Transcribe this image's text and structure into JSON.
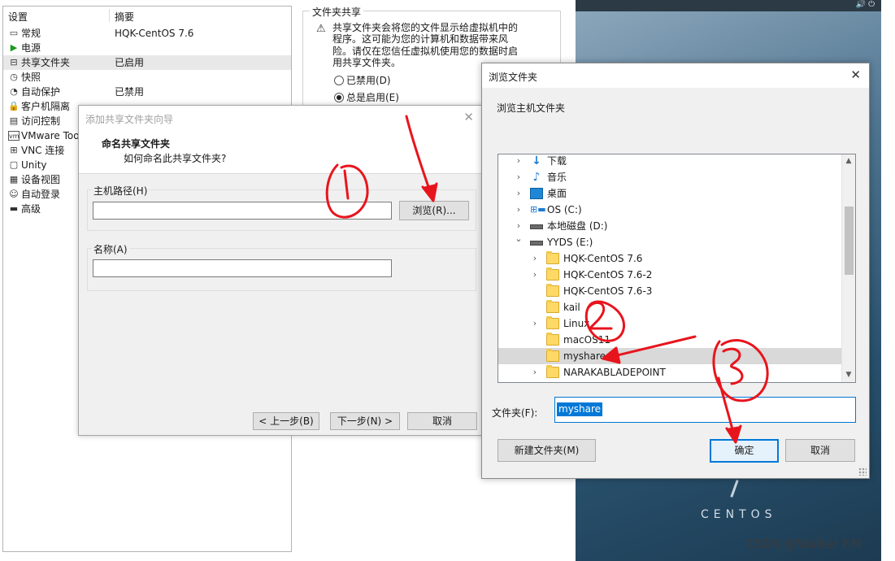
{
  "settings": {
    "header": {
      "col1": "设置",
      "col2": "摘要"
    },
    "items": [
      {
        "name": "常规",
        "value": "HQK-CentOS 7.6",
        "icon": "monitor-icon"
      },
      {
        "name": "电源",
        "value": "",
        "icon": "play-icon"
      },
      {
        "name": "共享文件夹",
        "value": "已启用",
        "icon": "shared-folder-icon"
      },
      {
        "name": "快照",
        "value": "",
        "icon": "snapshot-icon"
      },
      {
        "name": "自动保护",
        "value": "已禁用",
        "icon": "autoprotect-icon"
      },
      {
        "name": "客户机隔离",
        "value": "",
        "icon": "lock-icon"
      },
      {
        "name": "访问控制",
        "value": "",
        "icon": "access-control-icon"
      },
      {
        "name": "VMware Too",
        "value": "",
        "icon": "vmware-icon"
      },
      {
        "name": "VNC 连接",
        "value": "",
        "icon": "vnc-icon"
      },
      {
        "name": "Unity",
        "value": "",
        "icon": "unity-icon"
      },
      {
        "name": "设备视图",
        "value": "",
        "icon": "device-view-icon"
      },
      {
        "name": "自动登录",
        "value": "",
        "icon": "autologin-icon"
      },
      {
        "name": "高级",
        "value": "",
        "icon": "advanced-icon"
      }
    ]
  },
  "folder_share": {
    "title": "文件夹共享",
    "warning": "共享文件夹会将您的文件显示给虚拟机中的程序。这可能为您的计算机和数据带来风险。请仅在您信任虚拟机使用您的数据时启用共享文件夹。",
    "options": [
      "已禁用(D)",
      "总是启用(E)"
    ],
    "selected": "总是启用(E)"
  },
  "wizard": {
    "title": "添加共享文件夹向导",
    "heading": "命名共享文件夹",
    "subheading": "如何命名此共享文件夹?",
    "host_path_label": "主机路径(H)",
    "browse_button": "浏览(R)...",
    "name_label": "名称(A)",
    "back_button": "< 上一步(B)",
    "next_button": "下一步(N) >",
    "cancel_button": "取消"
  },
  "browse": {
    "title": "浏览文件夹",
    "description": "浏览主机文件夹",
    "tree": [
      {
        "label": "下载",
        "icon": "download-icon",
        "chevron": "right",
        "indent": 0
      },
      {
        "label": "音乐",
        "icon": "music-icon",
        "chevron": "right",
        "indent": 0
      },
      {
        "label": "桌面",
        "icon": "desktop-icon",
        "chevron": "right",
        "indent": 0
      },
      {
        "label": "OS (C:)",
        "icon": "os-drive-icon",
        "chevron": "right",
        "indent": 0
      },
      {
        "label": "本地磁盘 (D:)",
        "icon": "drive-icon",
        "chevron": "right",
        "indent": 0
      },
      {
        "label": "YYDS (E:)",
        "icon": "drive-icon",
        "chevron": "down",
        "indent": 0
      },
      {
        "label": "HQK-CentOS 7.6",
        "icon": "folder-icon",
        "chevron": "right",
        "indent": 1
      },
      {
        "label": "HQK-CentOS 7.6-2",
        "icon": "folder-icon",
        "chevron": "right",
        "indent": 1
      },
      {
        "label": "HQK-CentOS 7.6-3",
        "icon": "folder-icon",
        "chevron": "none",
        "indent": 1
      },
      {
        "label": "kail",
        "icon": "folder-icon",
        "chevron": "none",
        "indent": 1
      },
      {
        "label": "Linux",
        "icon": "folder-icon",
        "chevron": "right",
        "indent": 1
      },
      {
        "label": "macOS11",
        "icon": "folder-icon",
        "chevron": "none",
        "indent": 1
      },
      {
        "label": "myshare",
        "icon": "folder-icon",
        "chevron": "none",
        "indent": 1,
        "selected": true
      },
      {
        "label": "NARAKABLADEPOINT",
        "icon": "folder-icon",
        "chevron": "right",
        "indent": 1
      }
    ],
    "folder_label": "文件夹(F):",
    "folder_value": "myshare",
    "new_folder_button": "新建文件夹(M)",
    "ok_button": "确定",
    "cancel_button": "取消"
  },
  "vm": {
    "logo_text": "CENTOS"
  },
  "watermark": "CSDN @Walker F.M"
}
